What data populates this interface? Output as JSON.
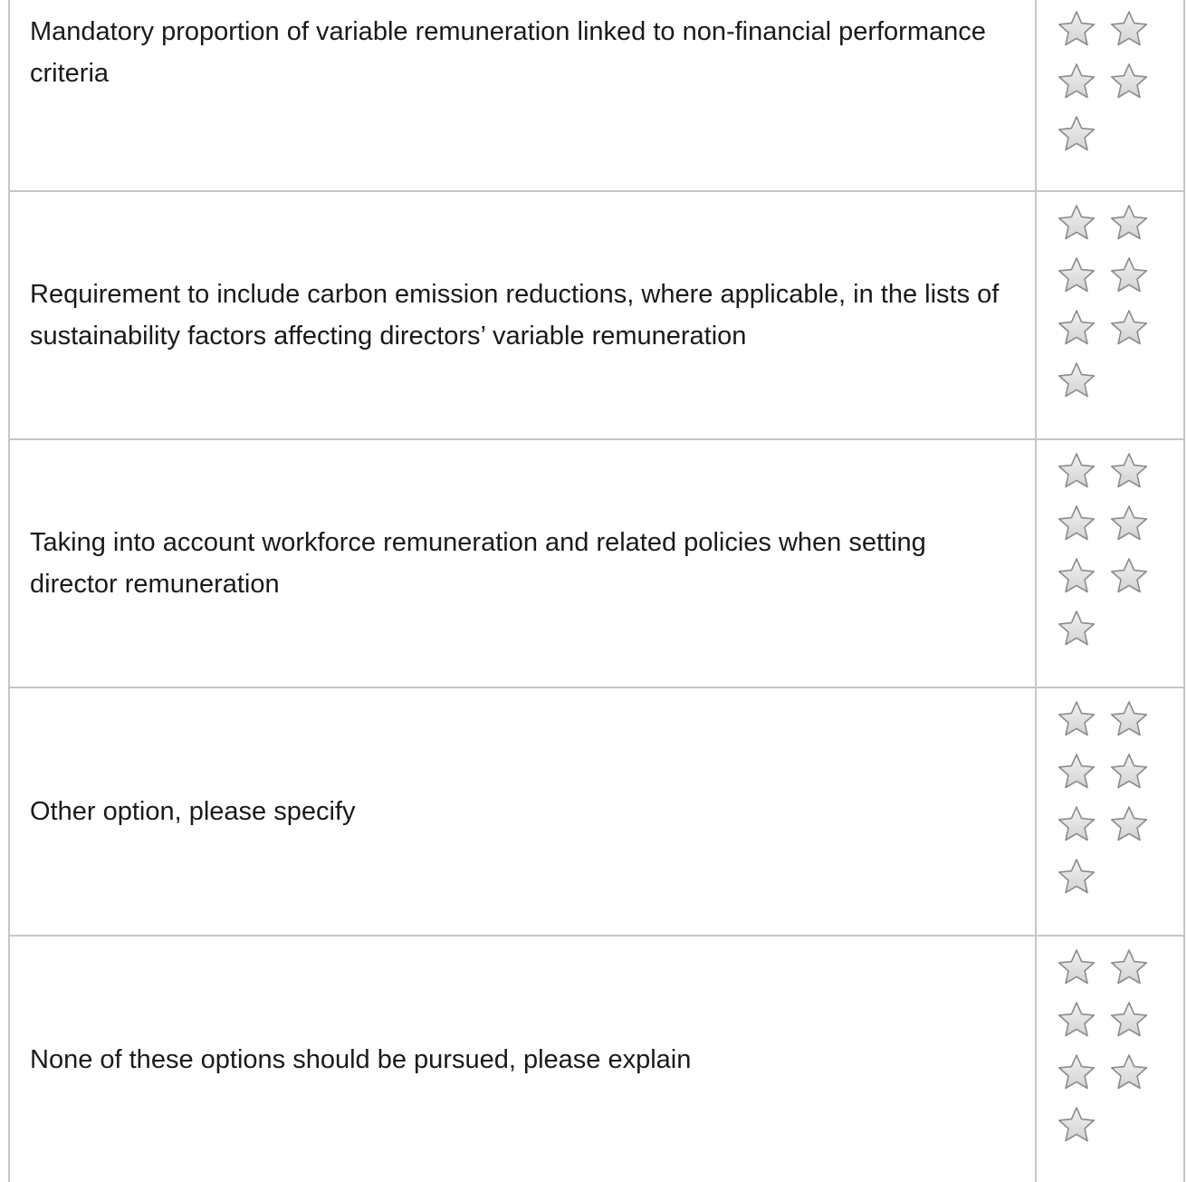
{
  "rows": [
    {
      "label": "Mandatory proportion of variable remuneration linked to non-financial performance criteria",
      "star_count": 5,
      "rating": 0
    },
    {
      "label": "Requirement to include carbon emission reductions, where applicable, in the lists of sustainability factors affecting directors’ variable remuneration",
      "star_count": 7,
      "rating": 0
    },
    {
      "label": "Taking into account workforce remuneration and related policies when setting director remuneration",
      "star_count": 7,
      "rating": 0
    },
    {
      "label": "Other option, please specify",
      "star_count": 7,
      "rating": 0
    },
    {
      "label": "None of these options should be pursued, please explain",
      "star_count": 7,
      "rating": 0
    }
  ],
  "icons": {
    "star": "star-icon"
  },
  "colors": {
    "star_fill": "#d2d2d2",
    "star_stroke": "#8c8c8c",
    "border": "#c6c6c6",
    "text": "#1a1a1a"
  }
}
